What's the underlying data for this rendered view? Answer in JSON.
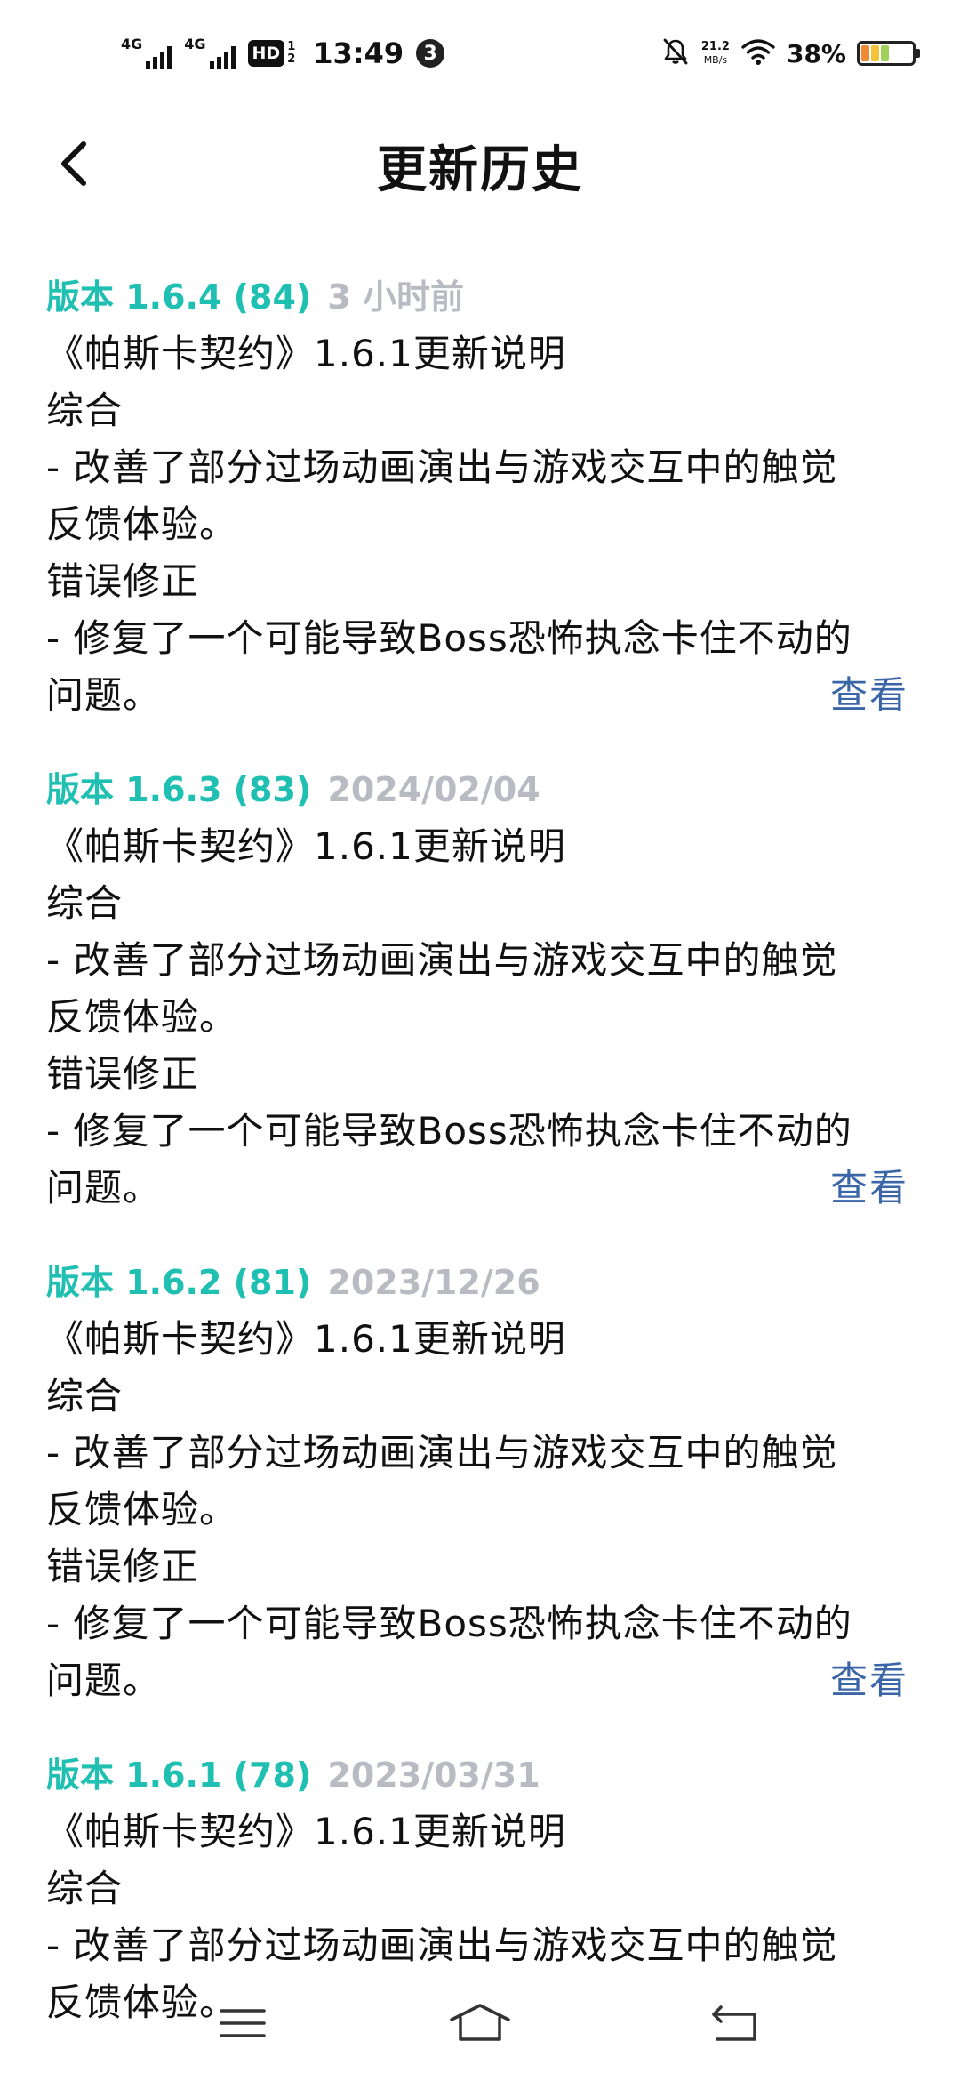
{
  "status_bar": {
    "net1": "4G",
    "net2": "4G",
    "hd": "HD",
    "hd_sup": "1",
    "hd_sub": "2",
    "time": "13:49",
    "notification_count": "3",
    "speed_value": "21.2",
    "speed_unit": "MB/s",
    "battery": "38%"
  },
  "header": {
    "title": "更新历史"
  },
  "entries": [
    {
      "version": "版本 1.6.4 (84)",
      "date": "3 小时前",
      "lines": [
        "《帕斯卡契约》1.6.1更新说明",
        "综合",
        "- 改善了部分过场动画演出与游戏交互中的触觉",
        "反馈体验。",
        "错误修正",
        "- 修复了一个可能导致Boss恐怖执念卡住不动的",
        "问题。"
      ],
      "view_label": "查看"
    },
    {
      "version": "版本 1.6.3 (83)",
      "date": "2024/02/04",
      "lines": [
        "《帕斯卡契约》1.6.1更新说明",
        "综合",
        "- 改善了部分过场动画演出与游戏交互中的触觉",
        "反馈体验。",
        "错误修正",
        "- 修复了一个可能导致Boss恐怖执念卡住不动的",
        "问题。"
      ],
      "view_label": "查看"
    },
    {
      "version": "版本 1.6.2 (81)",
      "date": "2023/12/26",
      "lines": [
        "《帕斯卡契约》1.6.1更新说明",
        "综合",
        "- 改善了部分过场动画演出与游戏交互中的触觉",
        "反馈体验。",
        "错误修正",
        "- 修复了一个可能导致Boss恐怖执念卡住不动的",
        "问题。"
      ],
      "view_label": "查看"
    },
    {
      "version": "版本 1.6.1 (78)",
      "date": "2023/03/31",
      "lines": [
        "《帕斯卡契约》1.6.1更新说明",
        "综合",
        "- 改善了部分过场动画演出与游戏交互中的触觉",
        "反馈体验。"
      ]
    }
  ],
  "colors": {
    "version_accent": "#1fc0b2",
    "date_gray": "#b8bcc2",
    "link_blue": "#3a66a8"
  },
  "icons": {
    "back": "chevron-left-icon",
    "menu": "menu-icon",
    "home": "home-icon",
    "back_nav": "back-arrow-icon"
  }
}
